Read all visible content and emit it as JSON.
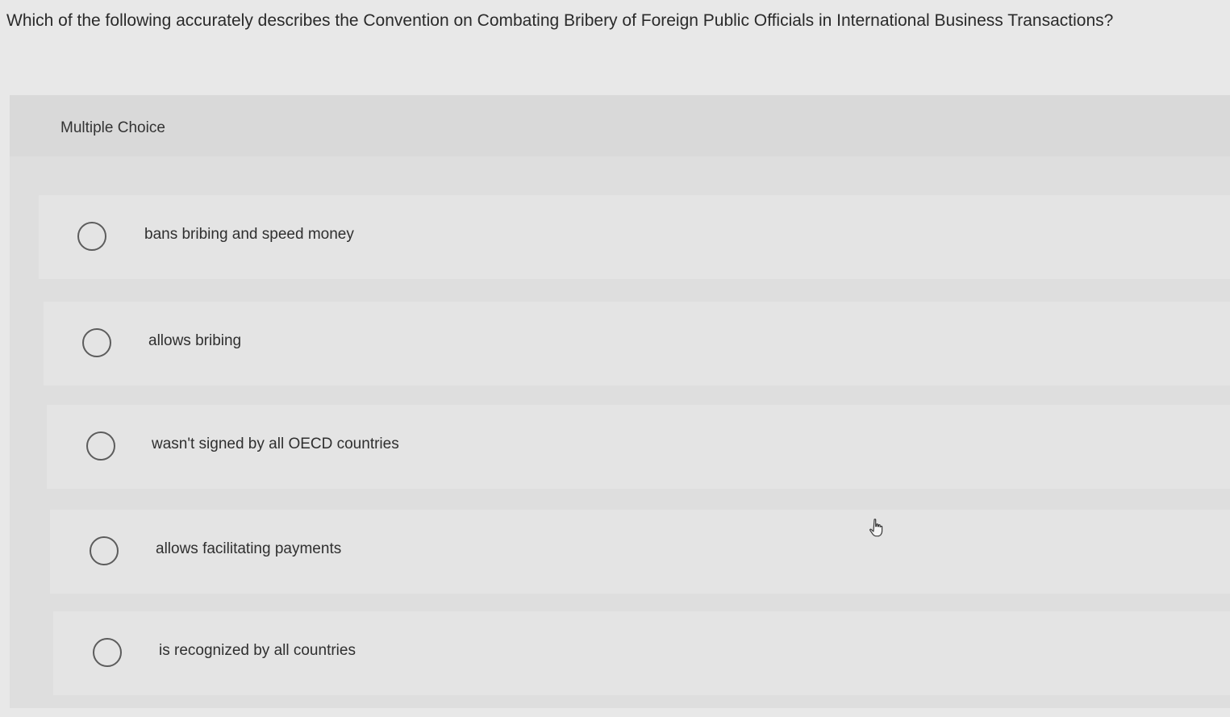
{
  "question": {
    "text": "Which of the following accurately describes the Convention on Combating Bribery of Foreign Public Officials in International Business Transactions?"
  },
  "panel": {
    "type_label": "Multiple Choice"
  },
  "choices": [
    {
      "label": "bans bribing and speed money",
      "selected": false
    },
    {
      "label": "allows bribing",
      "selected": false
    },
    {
      "label": "wasn't signed by all OECD countries",
      "selected": false
    },
    {
      "label": "allows facilitating payments",
      "selected": false
    },
    {
      "label": "is recognized by all countries",
      "selected": false
    }
  ],
  "icons": {
    "radio": "radio-unchecked-icon",
    "pointer": "hand-pointer-icon"
  },
  "colors": {
    "background": "#e8e8e8",
    "panel": "#dedede",
    "choice_row": "#e4e4e4",
    "text": "#2b2b2b",
    "radio_border": "#5c5c5c"
  }
}
